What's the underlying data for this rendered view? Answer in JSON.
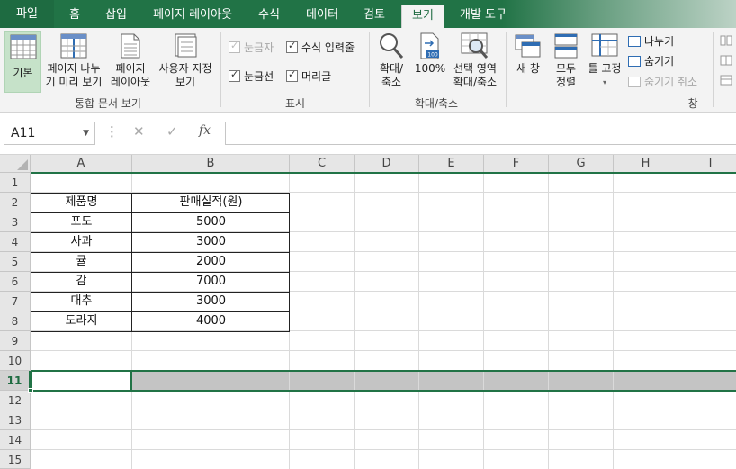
{
  "tabs": [
    {
      "label": "파일"
    },
    {
      "label": "홈"
    },
    {
      "label": "삽입"
    },
    {
      "label": "페이지 레이아웃"
    },
    {
      "label": "수식"
    },
    {
      "label": "데이터"
    },
    {
      "label": "검토"
    },
    {
      "label": "보기"
    },
    {
      "label": "개발 도구"
    }
  ],
  "ribbon": {
    "workbook_views": {
      "normal": "기본",
      "page_break_1": "페이지 나누",
      "page_break_2": "기 미리 보기",
      "page_layout_1": "페이지",
      "page_layout_2": "레이아웃",
      "custom_1": "사용자 지정",
      "custom_2": "보기",
      "group_label": "통합 문서 보기"
    },
    "show": {
      "ruler": "눈금자",
      "formula_bar": "수식 입력줄",
      "gridlines": "눈금선",
      "headings": "머리글",
      "group_label": "표시"
    },
    "zoom": {
      "zoom_1": "확대/",
      "zoom_2": "축소",
      "hundred": "100%",
      "selection_1": "선택 영역",
      "selection_2": "확대/축소",
      "group_label": "확대/축소"
    },
    "window": {
      "new_window": "새 창",
      "arrange_1": "모두",
      "arrange_2": "정렬",
      "freeze": "틀 고정",
      "split": "나누기",
      "hide": "숨기기",
      "unhide": "숨기기 취소",
      "group_label": "창"
    }
  },
  "formula_bar": {
    "name_box": "A11",
    "more": "⋮",
    "cancel": "✕",
    "enter": "✓",
    "fx": "fx",
    "value": ""
  },
  "sheet": {
    "columns": [
      "A",
      "B",
      "C",
      "D",
      "E",
      "F",
      "G",
      "H",
      "I"
    ],
    "rows": [
      "1",
      "2",
      "3",
      "4",
      "5",
      "6",
      "7",
      "8",
      "9",
      "10",
      "11",
      "12",
      "13",
      "14",
      "15"
    ],
    "header": {
      "product": "제품명",
      "sales": "판매실적(원)"
    },
    "records": [
      {
        "product": "포도",
        "sales": "5000"
      },
      {
        "product": "사과",
        "sales": "3000"
      },
      {
        "product": "귤",
        "sales": "2000"
      },
      {
        "product": "감",
        "sales": "7000"
      },
      {
        "product": "대추",
        "sales": "3000"
      },
      {
        "product": "도라지",
        "sales": "4000"
      }
    ]
  }
}
